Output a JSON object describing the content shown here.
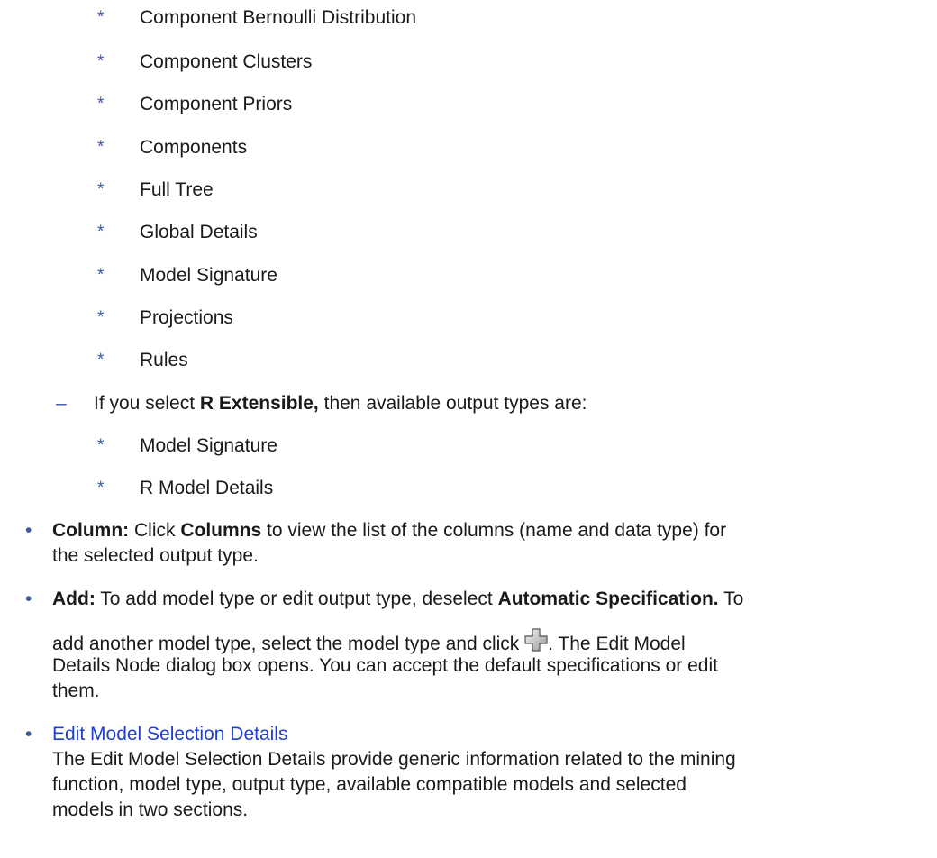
{
  "list_items": [
    "Component Bernoulli Distribution",
    "Component Clusters",
    "Component Priors",
    "Components",
    "Full Tree",
    "Global Details",
    "Model Signature",
    "Projections",
    "Rules"
  ],
  "r_extensible": {
    "prefix": "If you select ",
    "bold": "R Extensible,",
    "suffix": " then available output types are:",
    "items": [
      "Model Signature",
      "R Model Details"
    ]
  },
  "column": {
    "label": "Column:",
    "text1": " Click ",
    "bold": "Columns",
    "text2": " to view the list of the columns (name and data type) for",
    "line2": "the selected output type."
  },
  "add": {
    "label": "Add:",
    "text1": " To add model type or edit output type, deselect ",
    "bold": "Automatic Specification.",
    "text2": " To",
    "line2a": "add another model type, select the model type and click ",
    "line2b": ". The Edit Model",
    "line3": "Details Node dialog box opens. You can accept the default specifications or edit",
    "line4": "them."
  },
  "edit_selection": {
    "link": "Edit Model Selection Details",
    "line1": "The Edit Model Selection Details provide generic information related to the mining",
    "line2": "function, model type, output type, available compatible models and selected",
    "line3": "models in two sections."
  },
  "symbols": {
    "star": "*",
    "dash": "–",
    "bullet": "•",
    "add_icon": "add-plus-icon"
  },
  "colors": {
    "accent": "#3b5aa6",
    "link": "#1f3fcf",
    "text": "#1a1a1a"
  }
}
